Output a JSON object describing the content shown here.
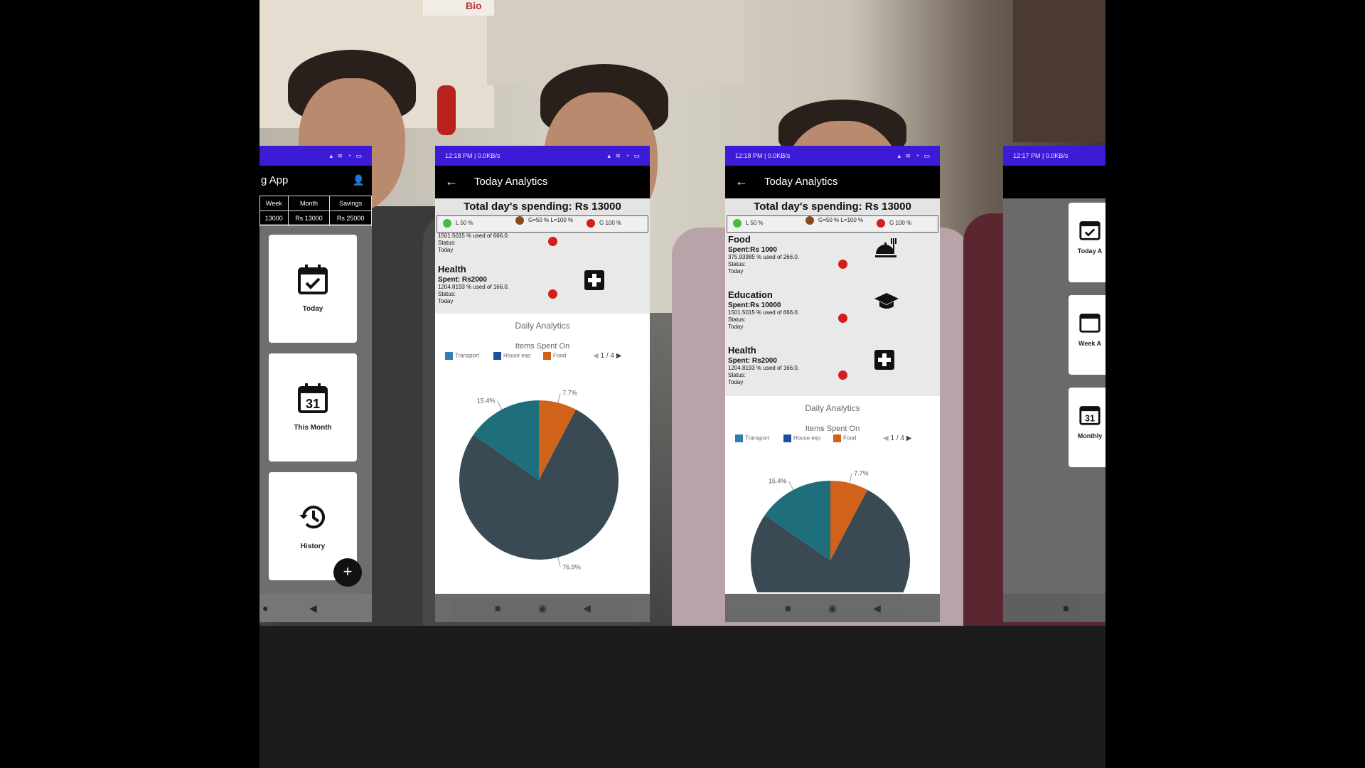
{
  "colors": {
    "statusbar": "#3d1ad6",
    "appbar": "#000000",
    "transport": "#2f7fb0",
    "house_exp": "#1f4f9b",
    "food": "#d06219",
    "pie_main": "#3a4a55",
    "pie_teal": "#1e6e7c",
    "legend_low": "#3fbf3f",
    "legend_mid": "#8a4a1a",
    "legend_high": "#d41d1d"
  },
  "photo": {
    "sign_text": "Bio"
  },
  "phone1": {
    "title": "g App",
    "user_icon": "person-icon",
    "summary_headers": [
      "Week",
      "Month",
      "Savings"
    ],
    "summary_values": [
      "13000",
      "Rs 13000",
      "Rs 25000"
    ],
    "cards": [
      {
        "label": "Today",
        "icon": "calendar-check-icon",
        "glyph": "📅"
      },
      {
        "label": "This Month",
        "icon": "calendar-31-icon",
        "glyph": "31"
      },
      {
        "label": "History",
        "icon": "history-icon",
        "glyph": "↺"
      }
    ],
    "fab_label": "+"
  },
  "phone2": {
    "status_time": "12:18 PM | 0.0KB/s",
    "title": "Today Analytics",
    "total": "Total day's spending: Rs 13000",
    "legend": [
      "L 50 %",
      "G=50 % L=100 %",
      "G 100 %"
    ],
    "partial_top": {
      "pct": "1501.5015 % used of 666.0.",
      "status_label": "Status:",
      "status": "Today"
    },
    "categories": [
      {
        "name": "Health",
        "spent": "Spent: Rs2000",
        "pct": "1204.8193 % used of 166.0.",
        "status_label": "Status:",
        "status": "Today",
        "icon": "plus-icon"
      }
    ],
    "daily_title": "Daily Analytics",
    "items_title": "Items Spent On",
    "legend_items": [
      "Transport",
      "House exp",
      "Food"
    ],
    "pager": "1 / 4"
  },
  "phone3": {
    "status_time": "12:18 PM | 0.0KB/s",
    "title": "Today Analytics",
    "total": "Total day's spending: Rs 13000",
    "legend": [
      "L 50 %",
      "G=50 % L=100 %",
      "G 100 %"
    ],
    "categories": [
      {
        "name": "Food",
        "spent": "Spent:Rs 1000",
        "pct": "375.93985 % used of 266.0.",
        "status_label": "Status:",
        "status": "Today",
        "icon": "food-icon"
      },
      {
        "name": "Education",
        "spent": "Spent:Rs 10000",
        "pct": "1501.5015 % used of 666.0.",
        "status_label": "Status:",
        "status": "Today",
        "icon": "graduation-cap-icon"
      },
      {
        "name": "Health",
        "spent": "Spent: Rs2000",
        "pct": "1204.8193 % used of 166.0.",
        "status_label": "Status:",
        "status": "Today",
        "icon": "plus-icon"
      }
    ],
    "daily_title": "Daily Analytics",
    "items_title": "Items Spent On",
    "legend_items": [
      "Transport",
      "House exp",
      "Food"
    ],
    "pager": "1 / 4"
  },
  "phone4": {
    "status_time": "12:17 PM | 0.0KB/s",
    "cards": [
      {
        "label": "Today A",
        "icon": "calendar-check-icon",
        "glyph": "📅"
      },
      {
        "label": "Week A",
        "icon": "calendar-icon",
        "glyph": "📅"
      },
      {
        "label": "Monthly",
        "icon": "calendar-31-icon",
        "glyph": "31"
      }
    ]
  },
  "chart_data": [
    {
      "type": "pie",
      "title": "Items Spent On",
      "categories": [
        "Food",
        "Education",
        "Health"
      ],
      "values": [
        7.7,
        76.9,
        15.4
      ],
      "labels": [
        "7.7%",
        "76.9%",
        "15.4%"
      ]
    },
    {
      "type": "pie",
      "title": "Items Spent On",
      "categories": [
        "Food",
        "Education",
        "Health"
      ],
      "values": [
        7.7,
        76.9,
        15.4
      ],
      "labels": [
        "7.7%",
        "15.4%"
      ]
    }
  ]
}
